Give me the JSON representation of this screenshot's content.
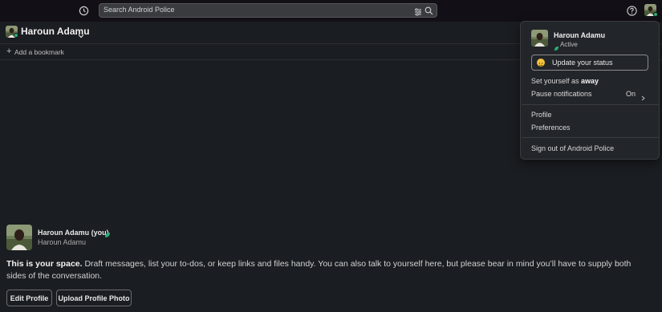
{
  "search": {
    "placeholder": "Search Android Police"
  },
  "header": {
    "name": "Haroun Adamu"
  },
  "bookmarks": {
    "plus": "+",
    "add_label": "Add a bookmark"
  },
  "intro": {
    "name": "Haroun Adamu (you)",
    "handle": "Haroun Adamu",
    "lead": "This is your space.",
    "body": " Draft messages, list your to-dos, or keep links and files handy. You can also talk to yourself here, but please bear in mind you’ll have to supply both sides of the conversation."
  },
  "buttons": {
    "edit_profile": "Edit Profile",
    "upload_photo": "Upload Profile Photo"
  },
  "menu": {
    "name": "Haroun Adamu",
    "status": "Active",
    "update_status": "Update your status",
    "set_away_prefix": "Set yourself as ",
    "set_away_bold": "away",
    "pause_notifications": "Pause notifications",
    "pause_value": "On",
    "profile": "Profile",
    "preferences": "Preferences",
    "sign_out": "Sign out of Android Police"
  },
  "colors": {
    "background": "#1a1d21",
    "topbar": "#121016",
    "active_green": "#2bac76",
    "menu_bg": "#222529"
  },
  "icons": [
    "history-icon",
    "filter-icon",
    "search-icon",
    "help-icon",
    "avatar",
    "chevron-down-icon",
    "leaf-status-icon",
    "smile-emoji-icon",
    "chevron-right-icon"
  ]
}
